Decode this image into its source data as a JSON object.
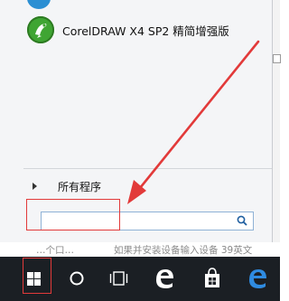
{
  "start_menu": {
    "app_items": [
      {
        "label": "CorelDRAW X4 SP2 精简增强版",
        "icon": "coreldraw-icon"
      }
    ],
    "all_programs_label": "所有程序",
    "search": {
      "value": "",
      "placeholder": ""
    }
  },
  "desktop_strip": {
    "left_text": "…个口…",
    "right_text": "如果并安装设备输入设备 39英文"
  },
  "taskbar": {
    "buttons": [
      {
        "icon": "windows-start-icon"
      },
      {
        "icon": "cortana-circle-icon"
      },
      {
        "icon": "task-view-icon"
      },
      {
        "icon": "edge-browser-icon"
      },
      {
        "icon": "store-bag-icon"
      },
      {
        "icon": "edge-browser-icon"
      }
    ]
  },
  "annotations": {
    "highlight_color": "#e23a3a"
  },
  "colors": {
    "taskbar_bg": "#1b1f24",
    "menu_bg": "#f4f5f7",
    "accent": "#2c8fd3"
  }
}
